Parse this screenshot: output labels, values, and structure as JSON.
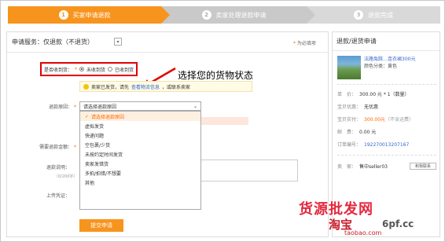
{
  "steps": [
    {
      "num": "1",
      "label": "买家申请退款"
    },
    {
      "num": "2",
      "label": "卖家处理退款申请"
    },
    {
      "num": "3",
      "label": "退款完成"
    }
  ],
  "form": {
    "service_label": "申请服务：",
    "service_value": "仅退款（不退货）",
    "service_arrow": "▾",
    "required_note_star": "*",
    "required_note": "为必填项",
    "annotation": "选择您的货物状态",
    "received_label": "是否收到货：",
    "received_star": "*",
    "radio_no": "未收到货",
    "radio_yes": "已收到货",
    "tip_text": "卖家已发货，请先",
    "tip_link": "查看物流信息",
    "tip_text2": "，或联系卖家",
    "reason_label": "退款原因：",
    "reason_star": "*",
    "reason_placeholder": "请选择退款原因",
    "reason_arrow": "⌄",
    "reason_options": [
      "请选择退款原因",
      "虚拟发货",
      "快递问题",
      "空包裹/少货",
      "未按约定时间发货",
      "卖家发错货",
      "多拍/拍错/不想要",
      "其他"
    ],
    "amount_label": "需要退款金额：",
    "amount_star": "*",
    "desc_label": "退款说明：",
    "desc_hint": "（0/200字）",
    "upload_label": "上传凭证：",
    "submit_label": "提交申请"
  },
  "sidebar": {
    "title": "退款/退货申请",
    "product_name": "法路兔踩…连衣裙300元",
    "product_color": "颜色分类：黄色",
    "unit_price_label": "单　价：",
    "unit_price": "300.00 元 * 1（数量）",
    "discount_label": "宝贝优惠：",
    "discount": "无优惠",
    "paid_label": "宝贝实付：",
    "paid": "300.00元",
    "paid_note": "（不含运费）",
    "shipping_label": "邮　费：",
    "shipping": "0.00 元",
    "order_label": "订单编号：",
    "order_no": "192270013207167",
    "seller_label": "卖　家：",
    "seller": "售中seller03",
    "contact_label": "和我联系"
  },
  "watermark": {
    "line1": "货源批发网",
    "line2": "淘宝",
    "line3": "6pf.cc",
    "line4": "taobao.com"
  }
}
